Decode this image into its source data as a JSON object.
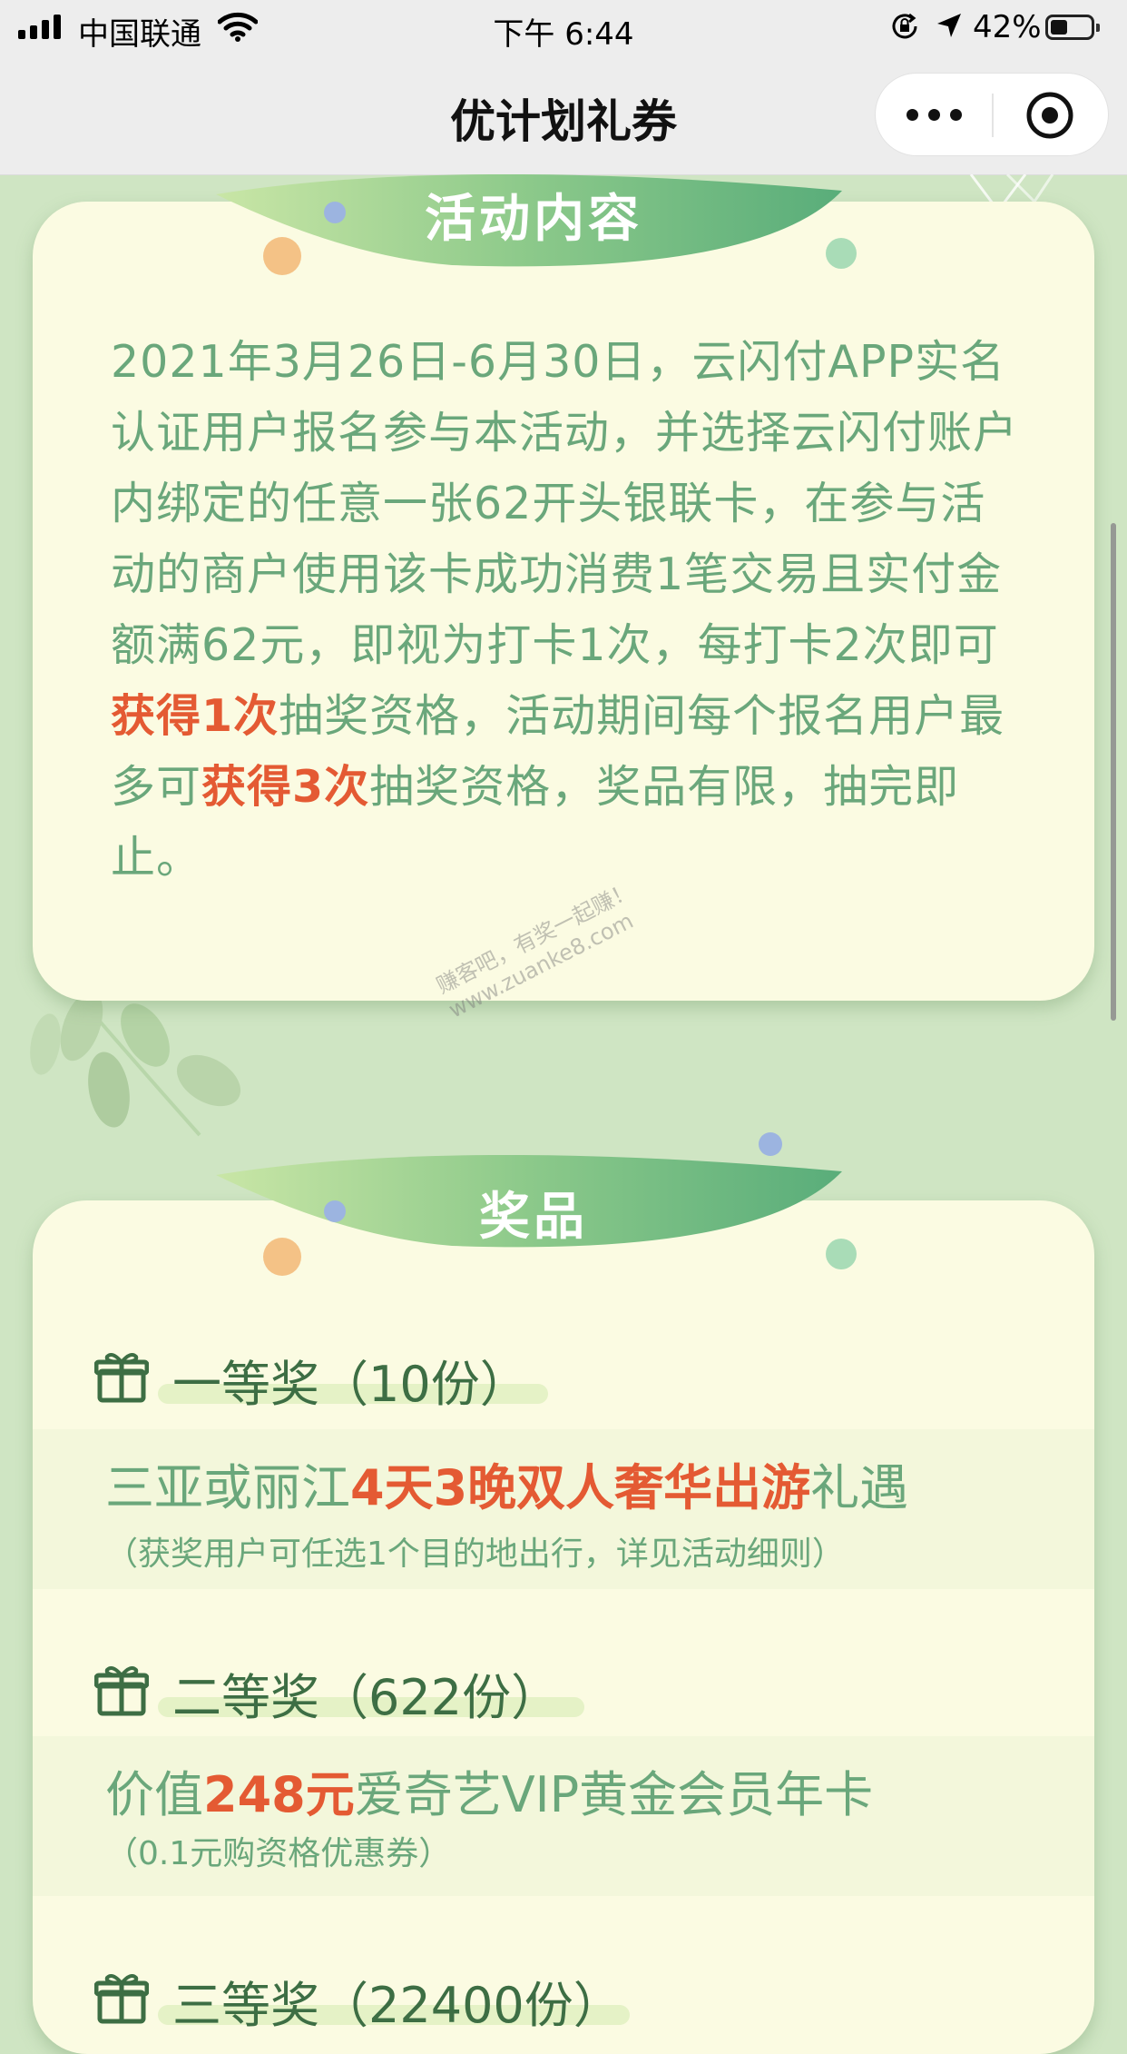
{
  "status_bar": {
    "carrier": "中国联通",
    "time": "下午 6:44",
    "battery_percent": "42%",
    "battery_level": 0.42
  },
  "nav": {
    "title": "优计划礼券"
  },
  "activity": {
    "heading": "活动内容",
    "para_a": "2021年3月26日-6月30日，云闪付APP实名认证用户报名参与本活动，并选择云闪付账户内绑定的任意一张62开头银联卡，在参与活动的商户使用该卡成功消费1笔交易且实付金额满62元，即视为打卡1次，每打卡2次即可",
    "hl_1": "获得1次",
    "para_b": "抽奖资格，活动期间每个报名用户最多可",
    "hl_2": "获得3次",
    "para_c": "抽奖资格，奖品有限，抽完即止。"
  },
  "prizes": {
    "heading": "奖品",
    "tiers": [
      {
        "label": "一等奖（10份）",
        "line_pre": "三亚或丽江",
        "line_hl": "4天3晚双人奢华出游",
        "line_post": "礼遇",
        "note": "（获奖用户可任选1个目的地出行，详见活动细则）"
      },
      {
        "label": "二等奖（622份）",
        "line_pre": "价值",
        "line_hl": "248元",
        "line_post": "爱奇艺VIP黄金会员年卡",
        "note": "（0.1元购资格优惠券）"
      },
      {
        "label": "三等奖（22400份）"
      }
    ]
  },
  "watermark": {
    "line1": "赚客吧，有奖一起赚！",
    "line2": "www.zuanke8.com"
  },
  "colors": {
    "page_bg": "#cfe5c3",
    "card_bg": "#fbfbe2",
    "text_green": "#6aa77b",
    "highlight": "#e45a33",
    "tier_green": "#3d6e44"
  },
  "icons": [
    "signal-icon",
    "wifi-icon",
    "orientation-lock-icon",
    "location-icon",
    "battery-icon",
    "more-icon",
    "close-circle-icon",
    "gift-icon",
    "leaf-decoration"
  ]
}
